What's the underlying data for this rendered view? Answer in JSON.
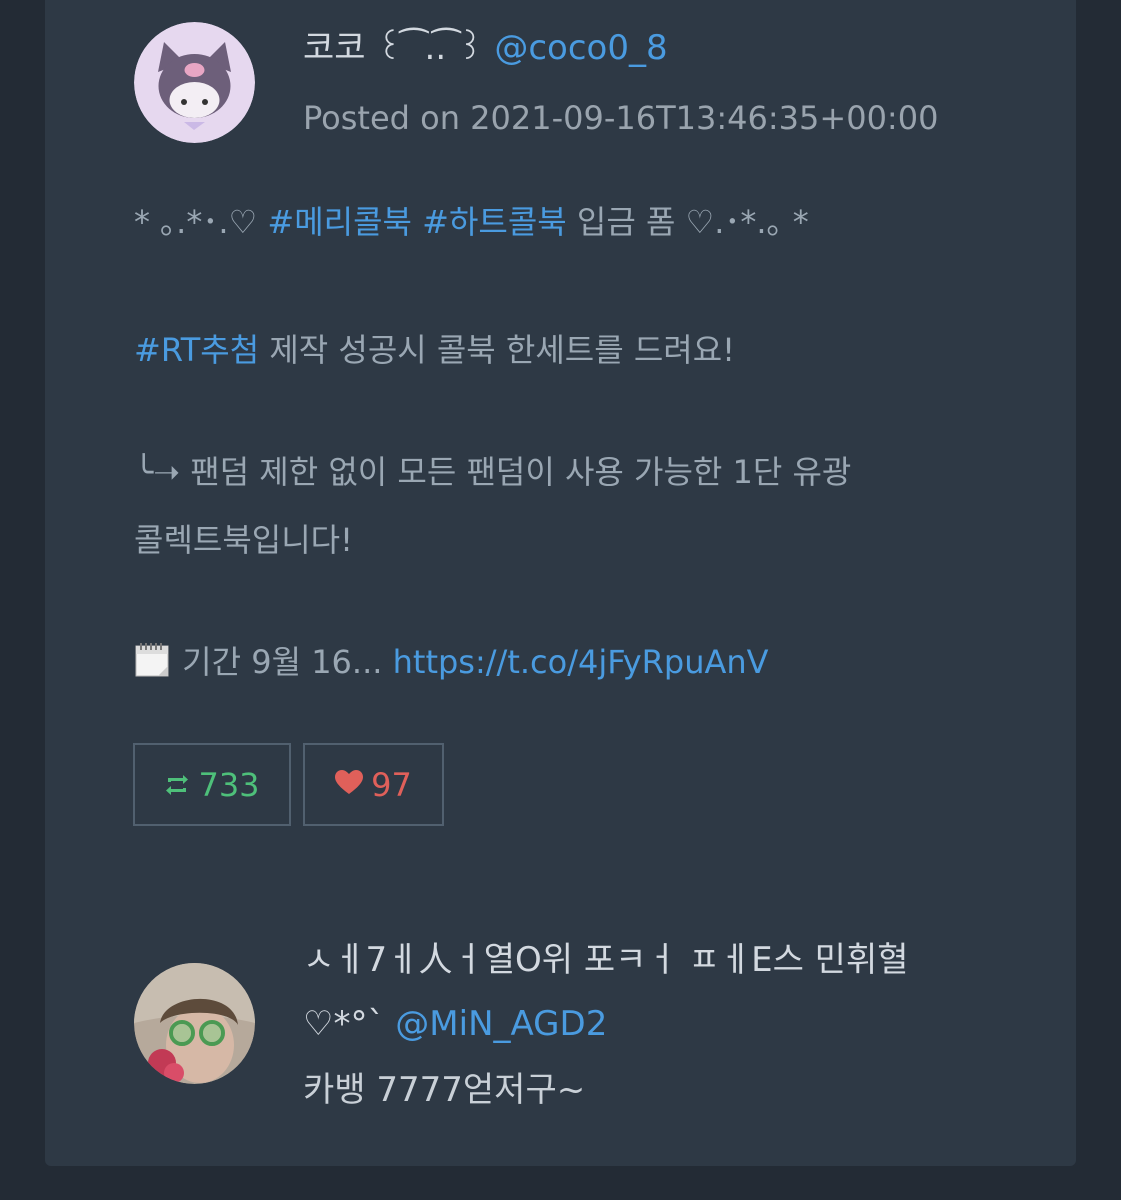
{
  "post": {
    "author_name": "코코 ꒰ ͡ ..͡ ꒱",
    "author_handle": "@coco0_8",
    "posted": "Posted on 2021-09-16T13:46:35+00:00",
    "line1_prefix": "* ｡.*･.♡ ",
    "line1_tag1": "#메리콜북",
    "line1_tag2": "#하트콜북",
    "line1_suffix": " 입금 폼 ♡.･*.｡ *",
    "line2_tag": "#RT추첨",
    "line2_text": " 제작 성공시 콜북 한세트를 드려요!",
    "line3": "╰➝ 팬덤 제한 없이 모든 팬덤이 사용 가능한 1단 유광",
    "line4": "콜렉트북입니다!",
    "line5_icon": "🗓",
    "line5_text": " 기간 9월 16... ",
    "line5_link": "https://t.co/4jFyRpuAnV",
    "retweet_count": "733",
    "like_count": "97"
  },
  "reply": {
    "author_name_line1": "ㅅㅔ7ㅔ人ㅓ열O위 포ㅋㅓ ㅍㅔE스 민휘혈",
    "author_name_line2": "♡*°` ",
    "author_handle": "@MiN_AGD2",
    "text": "카뱅 7777얻저구~"
  },
  "colors": {
    "background": "#232b35",
    "card": "#2e3945",
    "link": "#4a9be0",
    "retweet": "#4ec07a",
    "like": "#e0605a"
  },
  "icons": {
    "retweet": "retweet-icon",
    "like": "heart-icon",
    "calendar": "calendar-icon"
  }
}
